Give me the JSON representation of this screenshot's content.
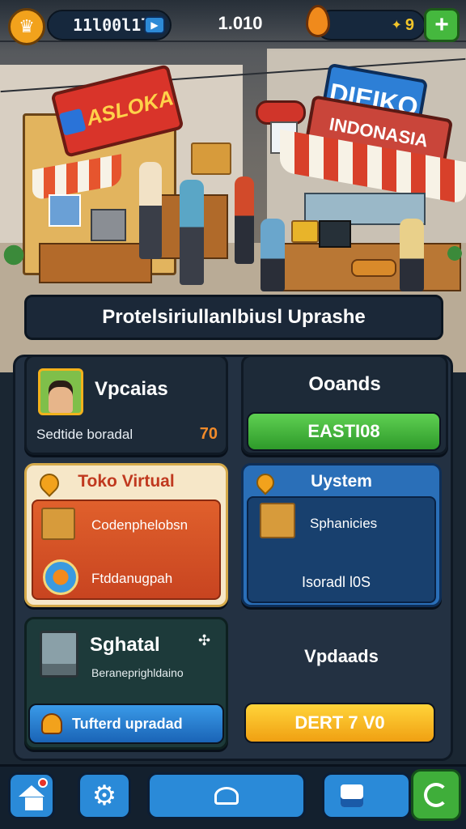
{
  "hud": {
    "currency_left": "11l00l1lS",
    "center_value": "1.010",
    "currency_right": "9"
  },
  "scene": {
    "left_sign": "ASLOKA",
    "right_sign_line1": "DIEIKO",
    "right_sign_line2": "INDONASIA"
  },
  "banner": {
    "title": "Protelsiriullanlbiusl Uprashe"
  },
  "cards": {
    "profile": {
      "title": "Vpcaias",
      "subtitle": "Sedtide boradal",
      "value": "70"
    },
    "goals": {
      "title": "Ooands",
      "button": "EASTI08"
    },
    "toko": {
      "title": "Toko Virtual",
      "item1": "Codenphelobsn",
      "item2": "Ftddanugpah"
    },
    "system": {
      "title": "Uystem",
      "item1": "Sphanicies",
      "item2": "Isoradl l0S"
    },
    "sghatal": {
      "title": "Sghatal",
      "subtitle": "Beraneprighldaino",
      "button": "Tufterd upradad"
    },
    "upgrades": {
      "title": "Vpdaads",
      "button": "DERT 7 V0"
    }
  },
  "colors": {
    "green": "#3fae3a",
    "orange": "#e8632a",
    "blue": "#1f74c8",
    "yellow": "#f2b21c"
  }
}
